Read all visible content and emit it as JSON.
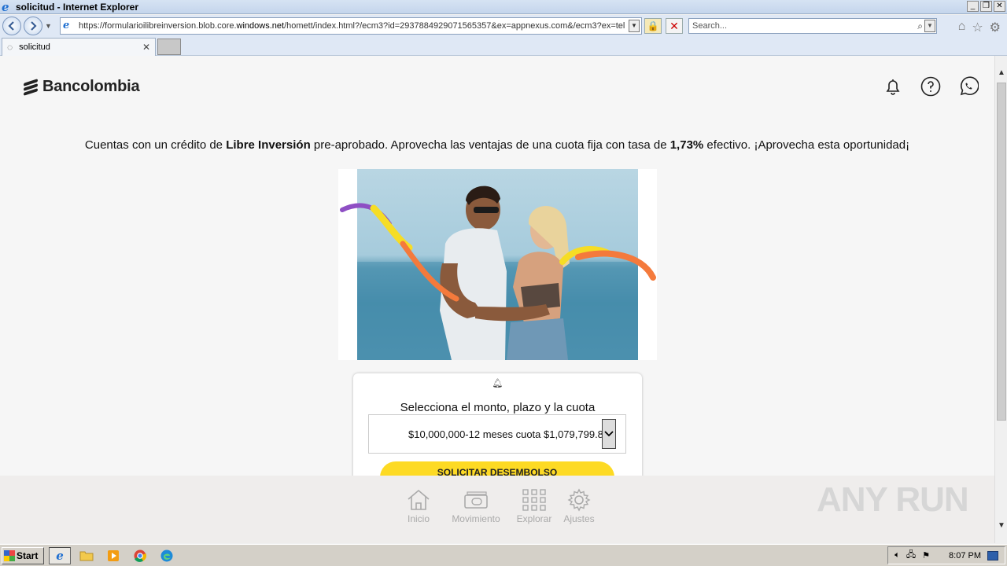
{
  "window": {
    "title": "solicitud - Internet Explorer",
    "controls": [
      "_",
      "❐",
      "✕"
    ]
  },
  "navbar": {
    "url_prefix": "https://formularioilibreinversion.blob.core.",
    "url_domain": "windows.net",
    "url_suffix": "/homett/index.html?/ecm3?id=2937884929071565357&ex=appnexus.com&/ecm3?ex=tel",
    "search_placeholder": "Search..."
  },
  "tab": {
    "label": "solicitud"
  },
  "page": {
    "brand": "Bancolombia",
    "promo_pre": "Cuentas con un crédito de ",
    "promo_bold1": "Libre Inversión",
    "promo_mid": " pre-aprobado. Aprovecha las ventajas de una cuota fija con tasa de ",
    "promo_bold2": "1,73%",
    "promo_post": " efectivo. ¡Aprovecha esta oportunidad¡",
    "card": {
      "title": "Selecciona el monto, plazo y la cuota",
      "selected_option": "$10,000,000-12 meses cuota $1,079,799.8",
      "cta": "SOLICITAR DESEMBOLSO"
    },
    "bottom_nav": [
      {
        "label": "Inicio",
        "icon": "home-icon"
      },
      {
        "label": "Movimiento",
        "icon": "money-icon"
      },
      {
        "label": "Explorar",
        "icon": "grid-icon"
      },
      {
        "label": "Ajustes",
        "icon": "gear-icon"
      }
    ]
  },
  "watermark": "ANY RUN",
  "taskbar": {
    "start": "Start",
    "clock": "8:07 PM"
  }
}
